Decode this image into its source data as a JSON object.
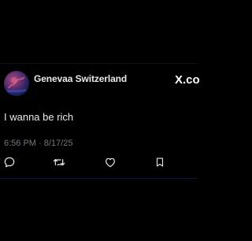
{
  "post": {
    "author_name": "Genevaa Switzerland",
    "text": "I wanna be rich",
    "timestamp": "6:56 PM · 8/17/25"
  },
  "brand": {
    "label": "X.co",
    "icon": "x-logo-icon"
  },
  "actions": [
    {
      "name": "reply",
      "icon": "reply-icon"
    },
    {
      "name": "repost",
      "icon": "repost-icon"
    },
    {
      "name": "like",
      "icon": "heart-icon"
    },
    {
      "name": "bookmark",
      "icon": "bookmark-icon"
    }
  ],
  "colors": {
    "background": "#000000",
    "text_primary": "#e7e9ea",
    "text_secondary": "#71767b",
    "divider_accent": "#101736"
  }
}
